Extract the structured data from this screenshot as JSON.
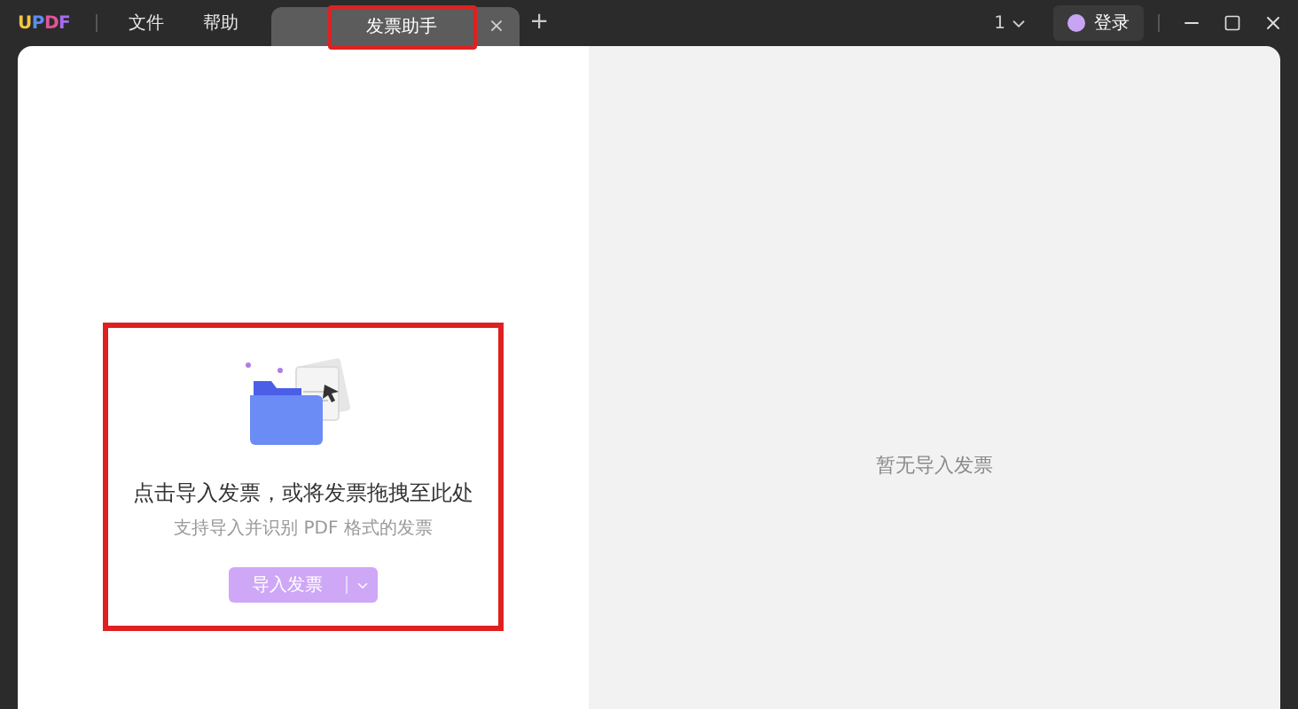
{
  "app": {
    "logo": "UPDF"
  },
  "menu": [
    "文件",
    "帮助"
  ],
  "tabs": [
    {
      "label": "发票助手",
      "selected": true,
      "close": "×"
    }
  ],
  "new_tab": "+",
  "titlebar_right": {
    "page_count": "1",
    "login": "登录"
  },
  "import_panel": {
    "heading": "点击导入发票，或将发票拖拽至此处",
    "subtext": "支持导入并识别 PDF 格式的发票",
    "button": "导入发票"
  },
  "preview_panel": {
    "empty_text": "暂无导入发票"
  }
}
